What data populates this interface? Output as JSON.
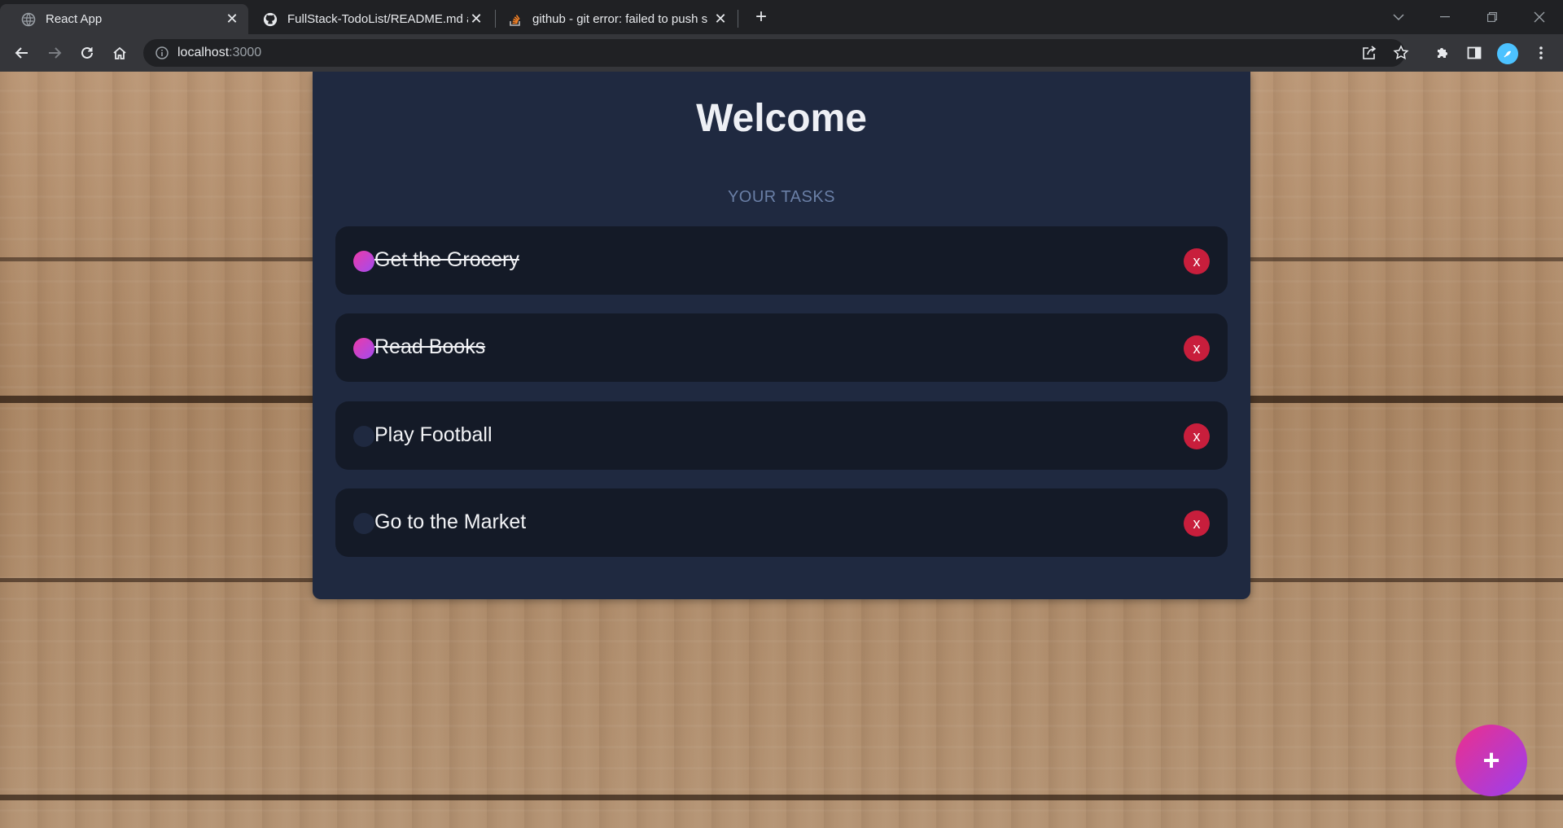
{
  "browser": {
    "tabs": [
      {
        "title": "React App",
        "icon": "globe-icon",
        "active": true
      },
      {
        "title": "FullStack-TodoList/README.md a",
        "icon": "github-icon",
        "active": false
      },
      {
        "title": "github - git error: failed to push s",
        "icon": "stackoverflow-icon",
        "active": false
      }
    ],
    "new_tab_label": "+",
    "address": {
      "host": "localhost",
      "port": ":3000"
    },
    "avatar_icon": "profile-icon"
  },
  "app": {
    "title": "Welcome",
    "section_label": "YOUR TASKS",
    "tasks": [
      {
        "text": "Get the Grocery",
        "done": true,
        "delete_label": "x"
      },
      {
        "text": "Read Books",
        "done": true,
        "delete_label": "x"
      },
      {
        "text": "Play Football",
        "done": false,
        "delete_label": "x"
      },
      {
        "text": "Go to the Market",
        "done": false,
        "delete_label": "x"
      }
    ],
    "add_button_label": "+"
  },
  "colors": {
    "card_bg": "#1f2940",
    "task_bg": "#141a27",
    "delete_red": "#c81e3c",
    "accent_pink": "#ec3aa8",
    "accent_purple": "#a14cf0"
  }
}
